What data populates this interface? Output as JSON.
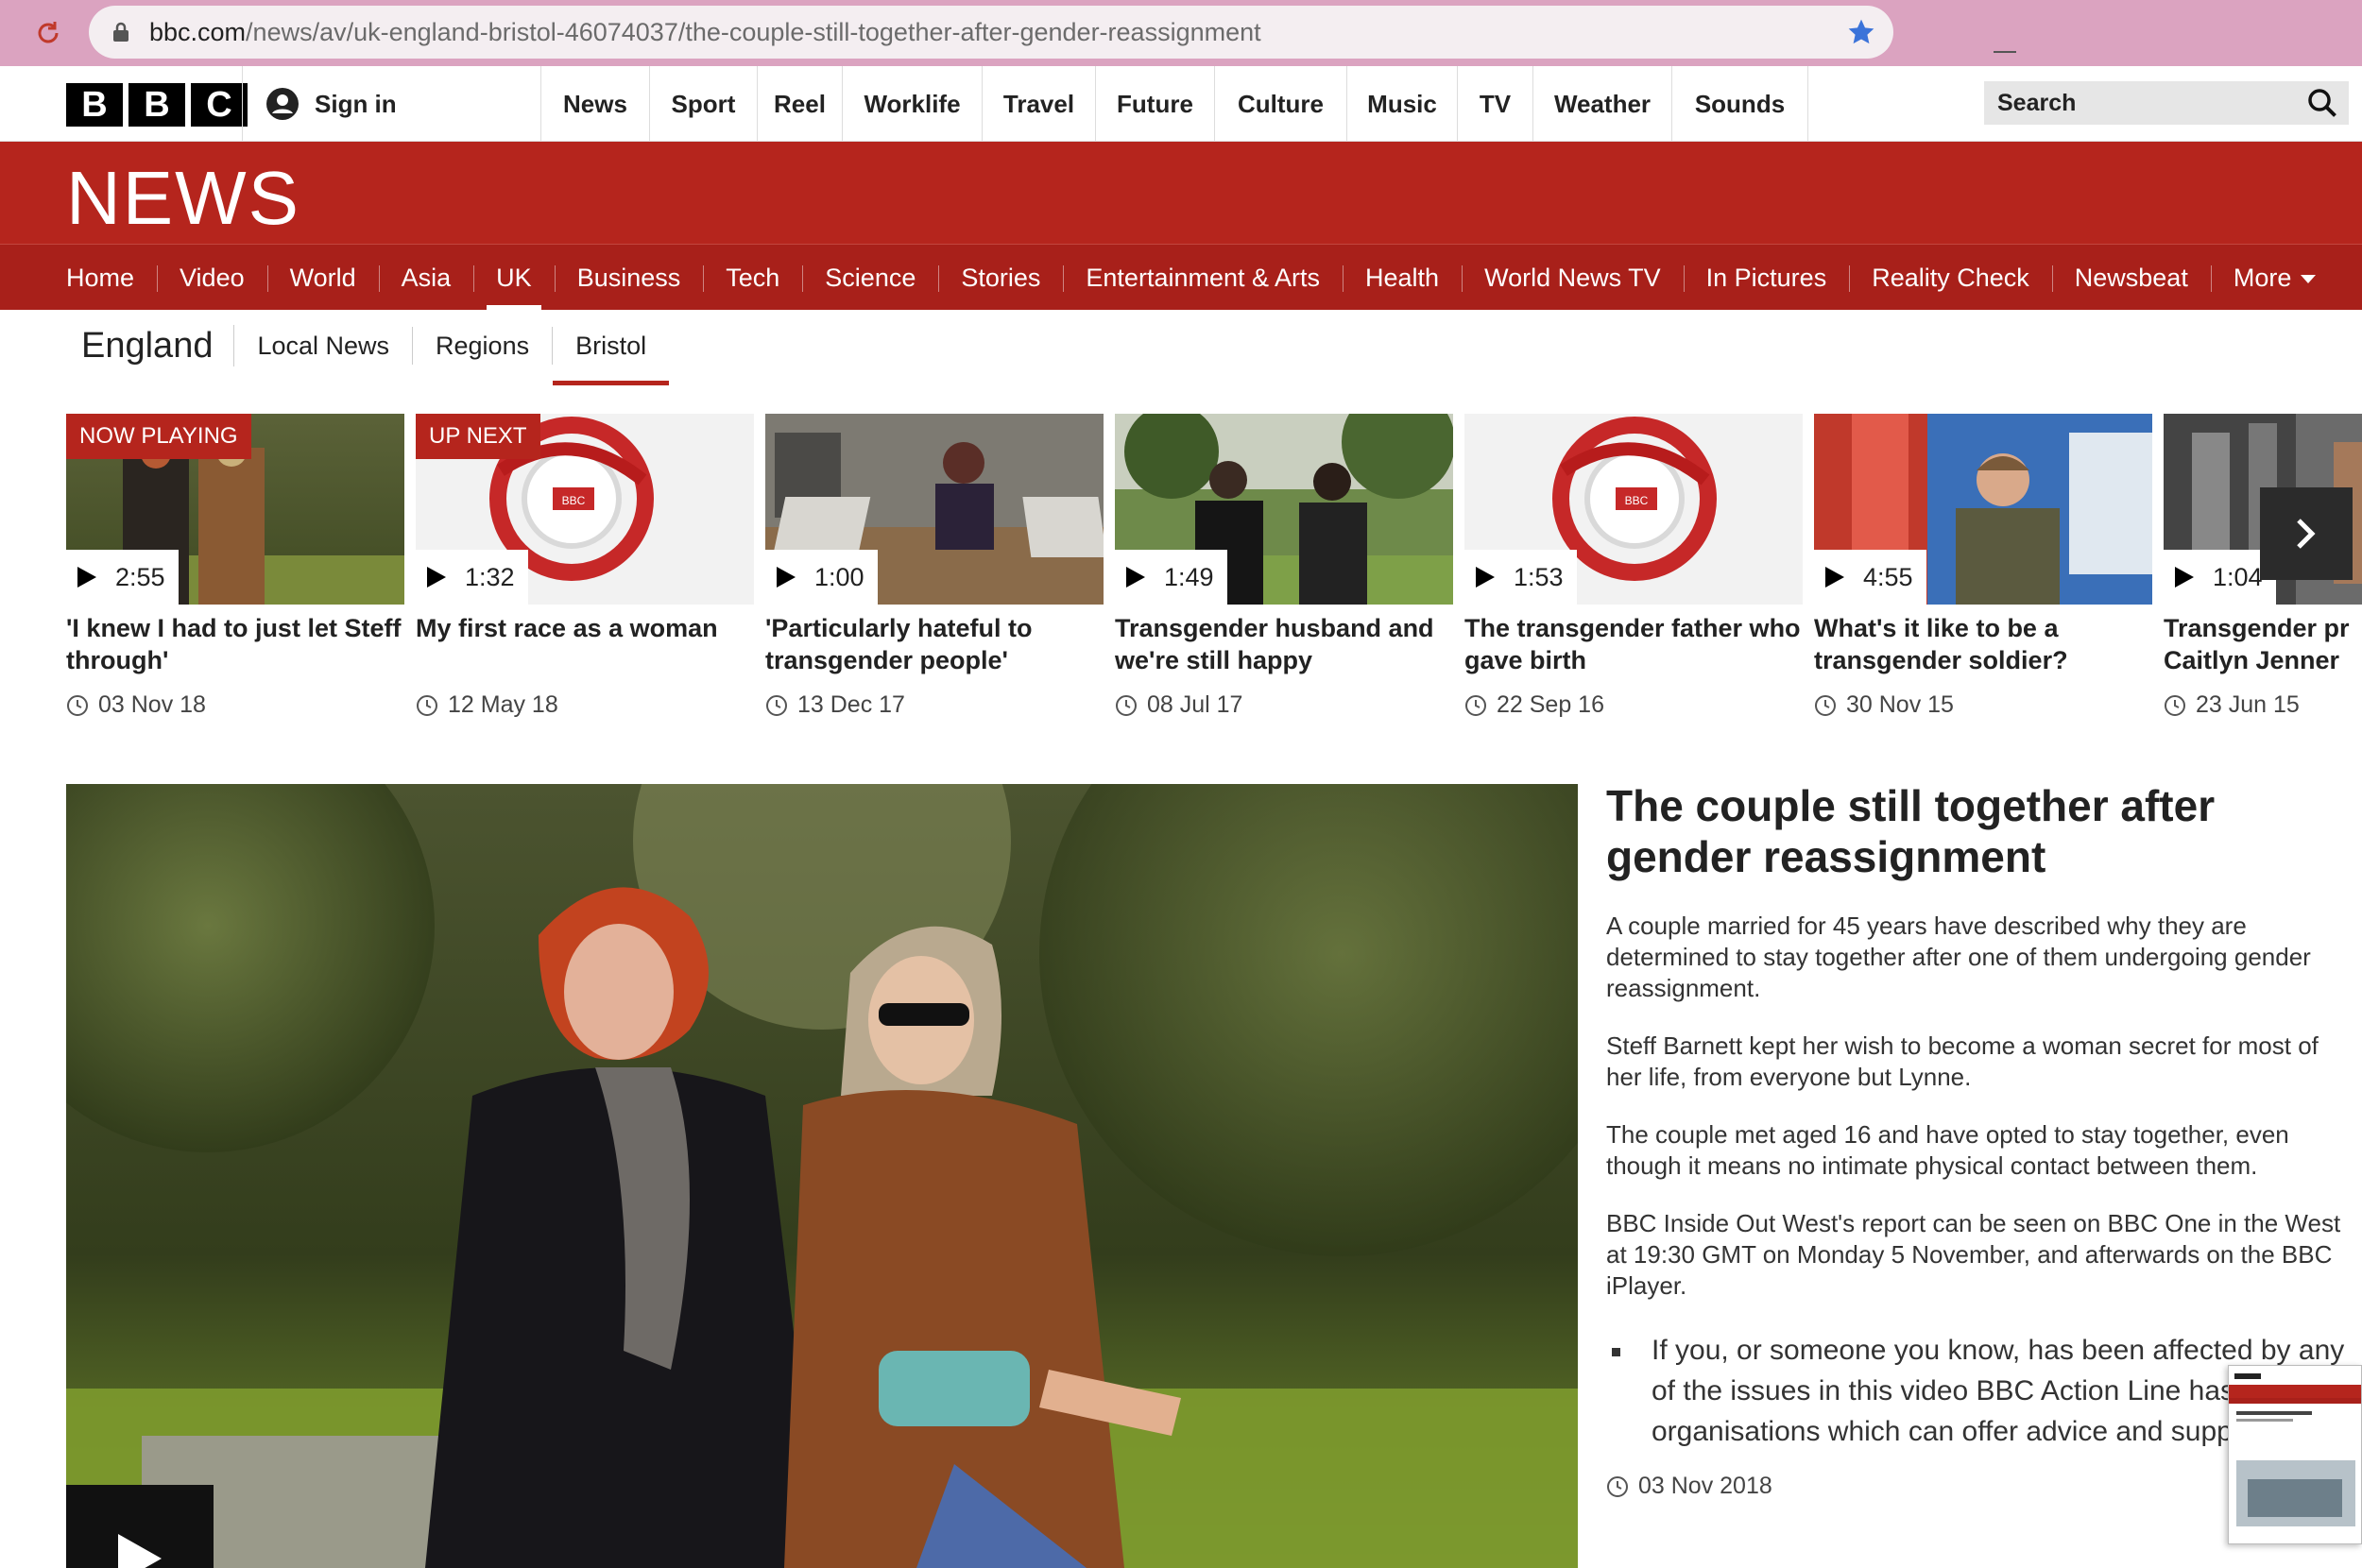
{
  "browser": {
    "url_host": "bbc.com",
    "url_path": "/news/av/uk-england-bristol-46074037/the-couple-still-together-after-gender-reassignment"
  },
  "topbar": {
    "logo": [
      "B",
      "B",
      "C"
    ],
    "sign_in": "Sign in",
    "nav": [
      "News",
      "Sport",
      "Reel",
      "Worklife",
      "Travel",
      "Future",
      "Culture",
      "Music",
      "TV",
      "Weather",
      "Sounds"
    ],
    "search_placeholder": "Search"
  },
  "news_band": {
    "title": "NEWS"
  },
  "section_nav": {
    "items": [
      "Home",
      "Video",
      "World",
      "Asia",
      "UK",
      "Business",
      "Tech",
      "Science",
      "Stories",
      "Entertainment & Arts",
      "Health",
      "World News TV",
      "In Pictures",
      "Reality Check",
      "Newsbeat",
      "More"
    ],
    "active": "UK"
  },
  "sub_nav": {
    "title": "England",
    "items": [
      "Local News",
      "Regions",
      "Bristol"
    ],
    "active": "Bristol"
  },
  "carousel": [
    {
      "badge": "NOW PLAYING",
      "duration": "2:55",
      "title_line1": "'I knew I had to just let Steff",
      "title_line2": "through'",
      "date": "03 Nov 18"
    },
    {
      "badge": "UP NEXT",
      "duration": "1:32",
      "title_line1": "My first race as a woman",
      "title_line2": "",
      "date": "12 May 18"
    },
    {
      "badge": "",
      "duration": "1:00",
      "title_line1": "'Particularly hateful to",
      "title_line2": "transgender people'",
      "date": "13 Dec 17"
    },
    {
      "badge": "",
      "duration": "1:49",
      "title_line1": "Transgender husband and",
      "title_line2": "we're still happy",
      "date": "08 Jul 17"
    },
    {
      "badge": "",
      "duration": "1:53",
      "title_line1": "The transgender father who",
      "title_line2": "gave birth",
      "date": "22 Sep 16"
    },
    {
      "badge": "",
      "duration": "4:55",
      "title_line1": "What's it like to be a",
      "title_line2": "transgender soldier?",
      "date": "30 Nov 15"
    },
    {
      "badge": "",
      "duration": "1:04",
      "title_line1": "Transgender pr",
      "title_line2": "Caitlyn Jenner",
      "date": "23 Jun 15"
    }
  ],
  "article": {
    "title": "The couple still together after gender reassignment",
    "paragraphs": [
      "A couple married for 45 years have described why they are determined to stay together after one of them undergoing gender reassignment.",
      "Steff Barnett kept her wish to become a woman secret for most of her life, from everyone but Lynne.",
      "The couple met aged 16 and have opted to stay together, even though it means no intimate physical contact between them.",
      "BBC Inside Out West's report can be seen on BBC One in the West at 19:30 GMT on Monday 5 November, and afterwards on the BBC iPlayer."
    ],
    "bullet": "If you, or someone you know, has been affected by any of the issues in this video BBC Action Line has details of organisations which can offer advice and support.",
    "date": "03 Nov 2018"
  },
  "colors": {
    "bbc_red": "#b5251d",
    "section_red": "#a8201a",
    "browser_pink": "#dba3c0"
  }
}
